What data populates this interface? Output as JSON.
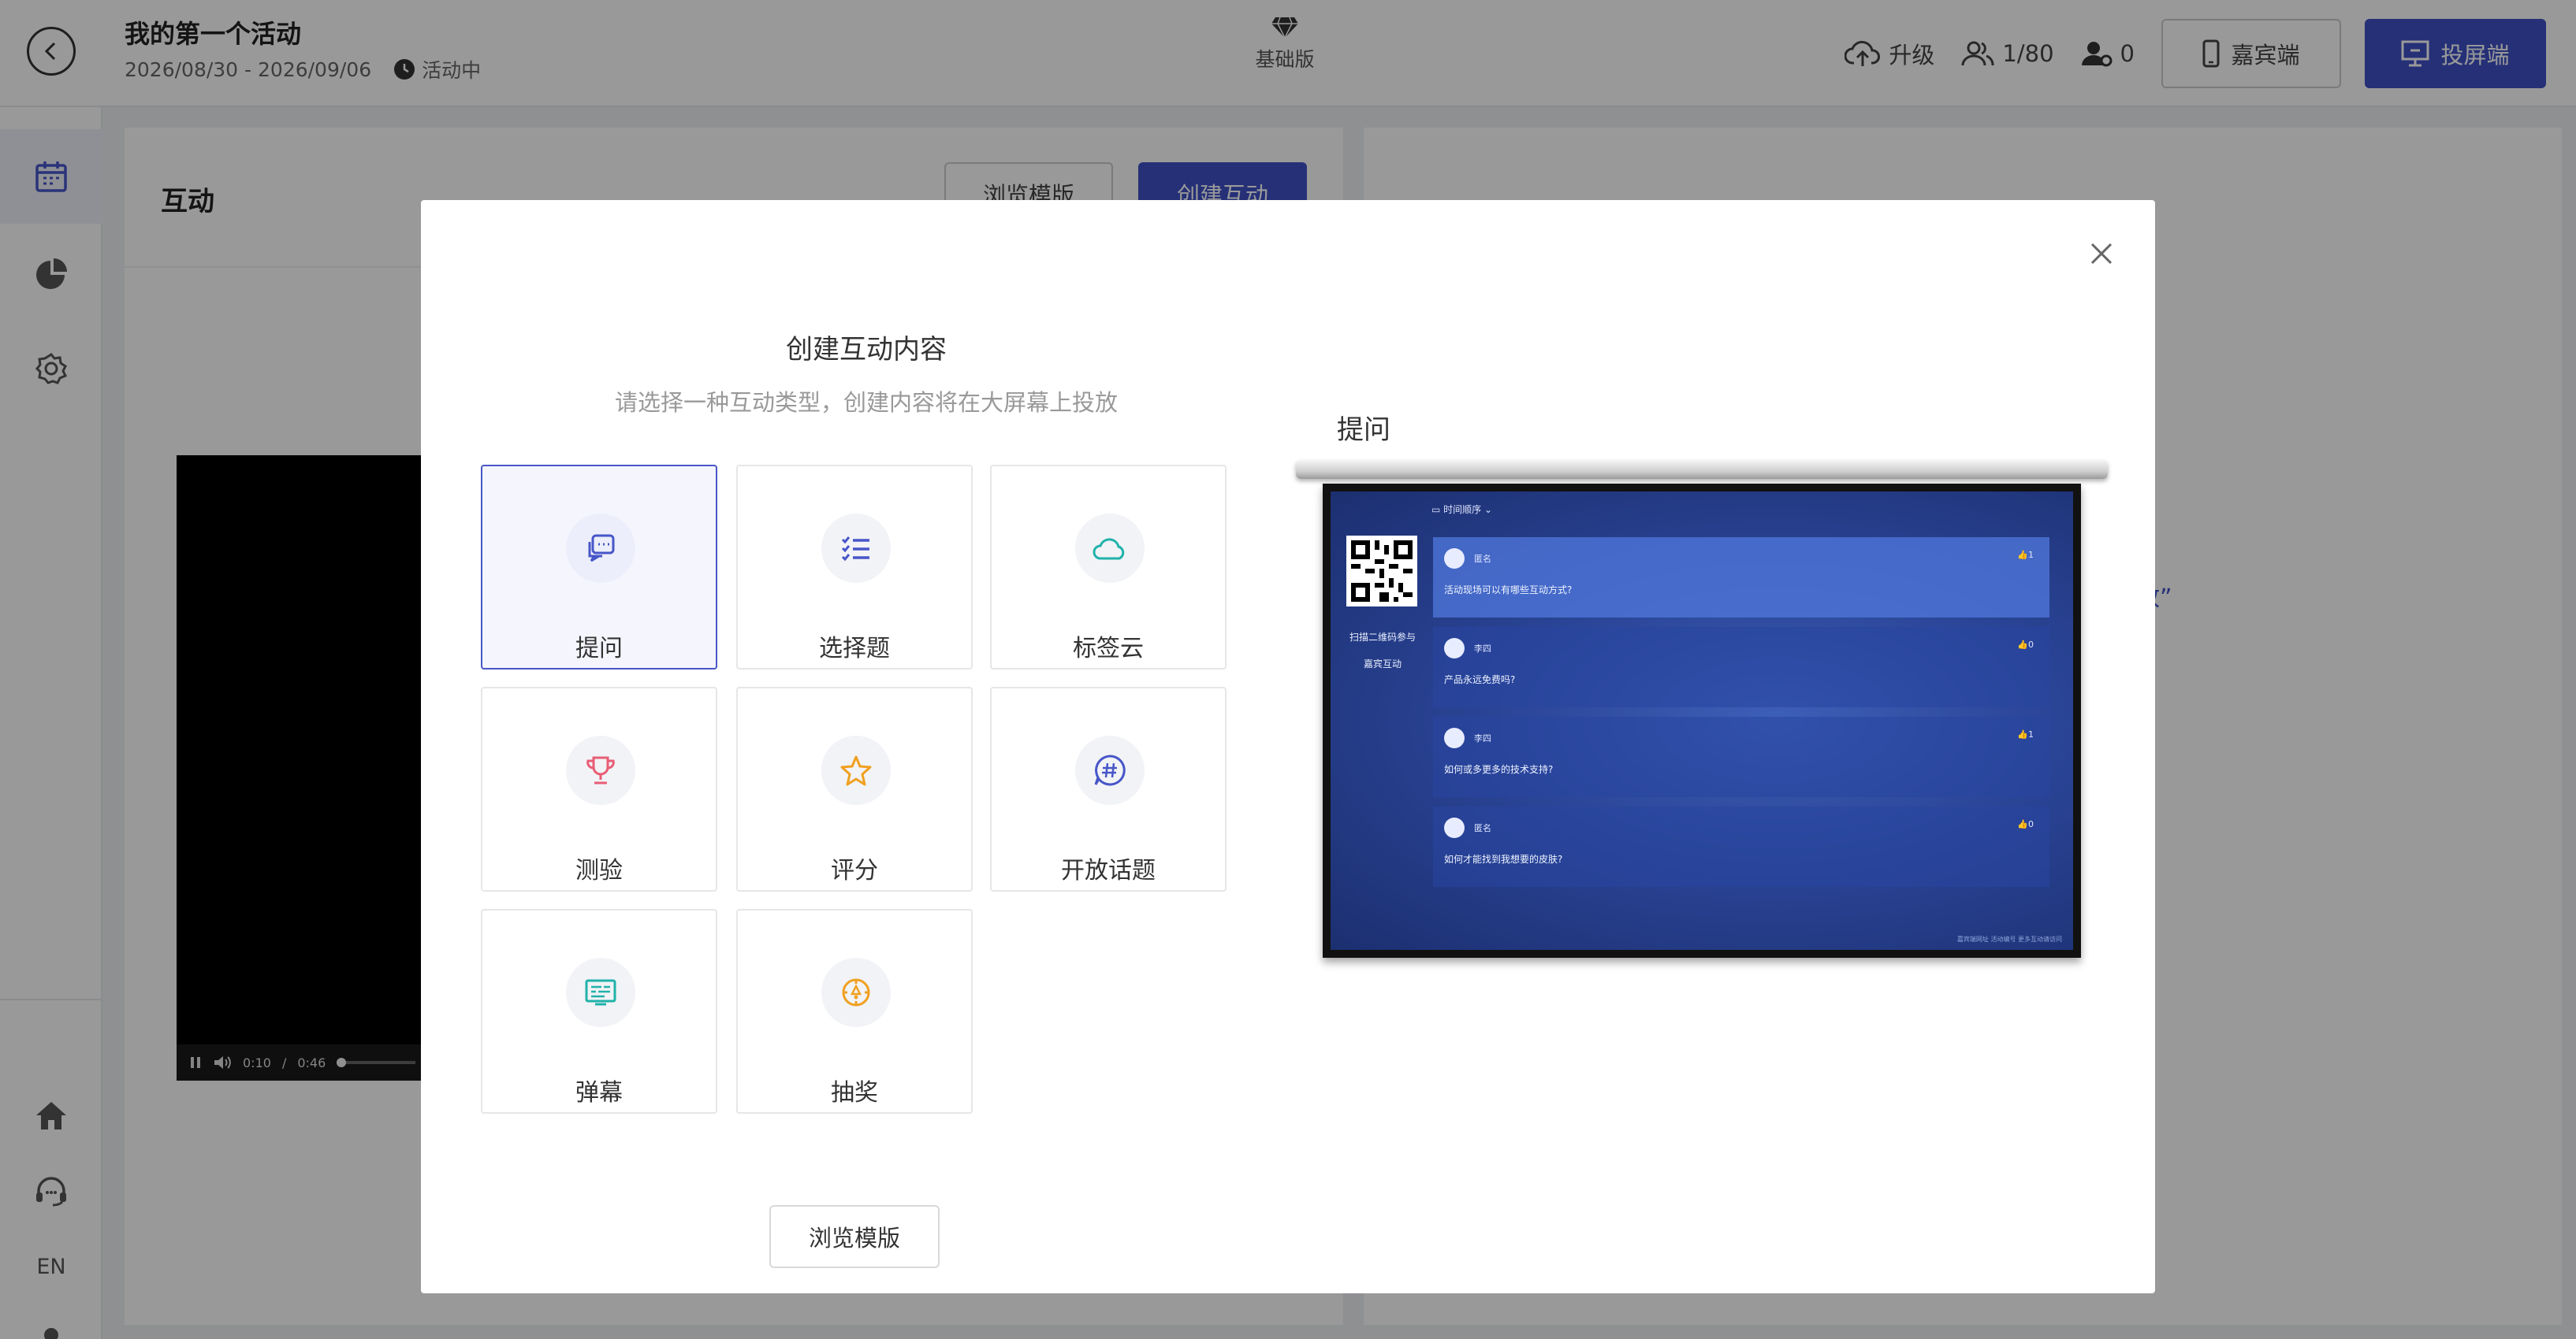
{
  "event": {
    "title": "我的第一个活动",
    "dates": "2026/08/30 - 2026/09/06",
    "status": "活动中"
  },
  "plan": {
    "label": "基础版"
  },
  "topbar": {
    "upgrade": "升级",
    "participants": "1/80",
    "online": "0",
    "guest_btn": "嘉宾端",
    "screen_btn": "投屏端"
  },
  "sidebar": {
    "lang": "EN"
  },
  "panel": {
    "title": "互动",
    "browse_btn": "浏览模版",
    "create_btn": "创建互动",
    "video_time": "0:10",
    "video_sep": "/",
    "video_total": "0:46",
    "right_fragment": "放”"
  },
  "modal": {
    "title": "创建互动内容",
    "subtitle": "请选择一种互动类型，创建内容将在大屏幕上投放",
    "tiles": [
      {
        "label": "提问",
        "icon": "chat-question-icon",
        "color": "#4756c8"
      },
      {
        "label": "选择题",
        "icon": "list-check-icon",
        "color": "#4756c8"
      },
      {
        "label": "标签云",
        "icon": "cloud-icon",
        "color": "#20b2aa"
      },
      {
        "label": "测验",
        "icon": "trophy-icon",
        "color": "#e85d75"
      },
      {
        "label": "评分",
        "icon": "star-icon",
        "color": "#f0a020"
      },
      {
        "label": "开放话题",
        "icon": "hashtag-chat-icon",
        "color": "#4756c8"
      },
      {
        "label": "弹幕",
        "icon": "danmaku-icon",
        "color": "#20b2aa"
      },
      {
        "label": "抽奖",
        "icon": "lottery-icon",
        "color": "#f0a020"
      }
    ],
    "browse_btn": "浏览模版",
    "preview_label": "提问"
  },
  "preview": {
    "sort_label": "时间顺序",
    "qr_text_1": "扫描二维码参与",
    "qr_text_2": "嘉宾互动",
    "questions": [
      {
        "name": "匿名",
        "text": "活动现场可以有哪些互动方式?",
        "likes": "1"
      },
      {
        "name": "李四",
        "text": "产品永远免费吗?",
        "likes": "0"
      },
      {
        "name": "李四",
        "text": "如何或多更多的技术支持?",
        "likes": "1"
      },
      {
        "name": "匿名",
        "text": "如何才能找到我想要的皮肤?",
        "likes": "0"
      }
    ],
    "footer": "嘉宾端网址  活动编号  更多互动请访问"
  }
}
